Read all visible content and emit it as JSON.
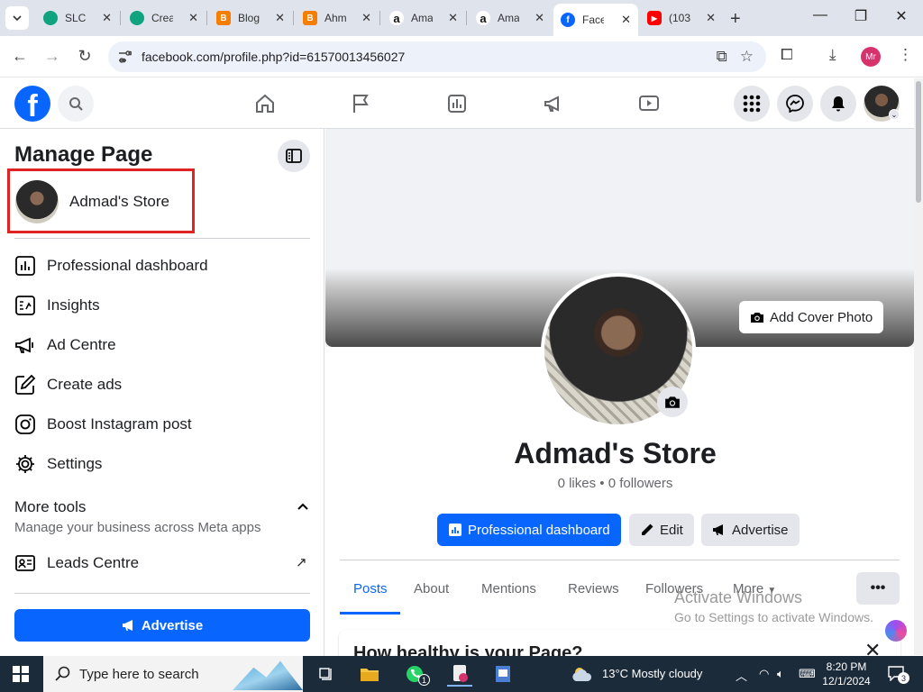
{
  "browser": {
    "tabs": [
      {
        "title": "SLC-",
        "favicon": "slc-icon",
        "color": "#10a37f"
      },
      {
        "title": "Crea",
        "favicon": "chatgpt-icon",
        "color": "#10a37f"
      },
      {
        "title": "Blog",
        "favicon": "blogger-icon",
        "color": "#f57d00"
      },
      {
        "title": "Ahm",
        "favicon": "blogger-icon",
        "color": "#f57d00"
      },
      {
        "title": "Ama",
        "favicon": "amazon-icon",
        "color": "#222222"
      },
      {
        "title": "Ama",
        "favicon": "amazon-icon",
        "color": "#222222"
      },
      {
        "title": "Face",
        "favicon": "facebook-icon",
        "color": "#0866ff",
        "active": true
      },
      {
        "title": "(103",
        "favicon": "youtube-icon",
        "color": "#ff0000"
      }
    ],
    "url": "facebook.com/profile.php?id=61570013456027",
    "profile_initials": "Mr"
  },
  "sidebar": {
    "title": "Manage Page",
    "page_name": "Admad's Store",
    "items": [
      {
        "label": "Professional dashboard",
        "icon": "dashboard-icon"
      },
      {
        "label": "Insights",
        "icon": "insights-icon"
      },
      {
        "label": "Ad Centre",
        "icon": "megaphone-icon"
      },
      {
        "label": "Create ads",
        "icon": "pencil-icon"
      },
      {
        "label": "Boost Instagram post",
        "icon": "instagram-icon"
      },
      {
        "label": "Settings",
        "icon": "gear-icon"
      }
    ],
    "more_tools": {
      "title": "More tools",
      "subtitle": "Manage your business across Meta apps",
      "items": [
        {
          "label": "Leads Centre",
          "icon": "contact-card-icon"
        }
      ]
    },
    "advertise_label": "Advertise"
  },
  "profile": {
    "add_cover_label": "Add Cover Photo",
    "name": "Admad's Store",
    "stats": "0 likes • 0 followers",
    "buttons": {
      "dashboard": "Professional dashboard",
      "edit": "Edit",
      "advertise": "Advertise"
    },
    "tabs": [
      "Posts",
      "About",
      "Mentions",
      "Reviews",
      "Followers",
      "More"
    ],
    "more_button": "•••",
    "health_card_title": "How healthy is your Page?"
  },
  "watermark": {
    "line1": "Activate Windows",
    "line2": "Go to Settings to activate Windows."
  },
  "taskbar": {
    "search_placeholder": "Type here to search",
    "weather": "13°C  Mostly cloudy",
    "time": "8:20 PM",
    "date": "12/1/2024",
    "whatsapp_badge": "1",
    "notification_count": "3"
  },
  "colors": {
    "fb_blue": "#0866ff",
    "highlight_red": "#e02424"
  }
}
